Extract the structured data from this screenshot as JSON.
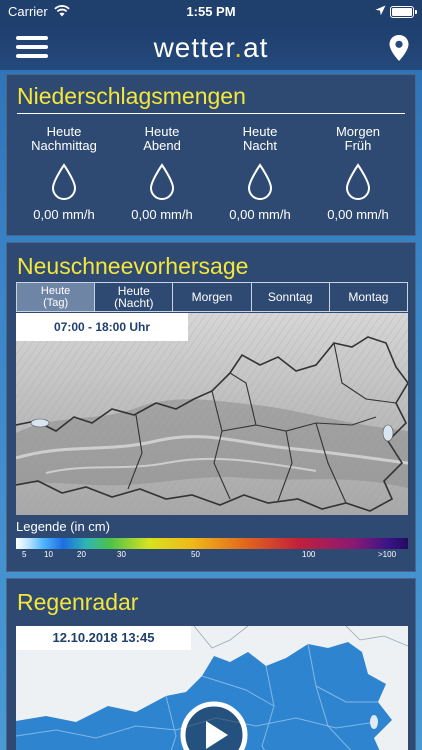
{
  "status_bar": {
    "carrier": "Carrier",
    "time": "1:55 PM"
  },
  "header": {
    "logo_main": "wetter",
    "logo_dot": ".",
    "logo_tld": "at"
  },
  "precipitation": {
    "title": "Niederschlagsmengen",
    "columns": [
      {
        "line1": "Heute",
        "line2": "Nachmittag",
        "value": "0,00 mm/h"
      },
      {
        "line1": "Heute",
        "line2": "Abend",
        "value": "0,00 mm/h"
      },
      {
        "line1": "Heute",
        "line2": "Nacht",
        "value": "0,00 mm/h"
      },
      {
        "line1": "Morgen",
        "line2": "Früh",
        "value": "0,00 mm/h"
      }
    ]
  },
  "snow": {
    "title": "Neuschneevorhersage",
    "tabs": [
      {
        "line1": "Heute",
        "line2": "(Tag)",
        "active": true
      },
      {
        "line1": "Heute",
        "line2": "(Nacht)",
        "active": false
      },
      {
        "line1": "Morgen",
        "line2": "",
        "active": false
      },
      {
        "line1": "Sonntag",
        "line2": "",
        "active": false
      },
      {
        "line1": "Montag",
        "line2": "",
        "active": false
      }
    ],
    "time_range": "07:00 - 18:00 Uhr",
    "legend_title": "Legende (in cm)",
    "legend_ticks": [
      "5",
      "10",
      "20",
      "30",
      "50",
      "100",
      ">100"
    ]
  },
  "radar": {
    "title": "Regenradar",
    "timestamp": "12.10.2018 13:45"
  },
  "colors": {
    "accent_yellow": "#f5e63c",
    "card_bg": "#2e4a72",
    "nav_bg": "#1f3f6d"
  }
}
